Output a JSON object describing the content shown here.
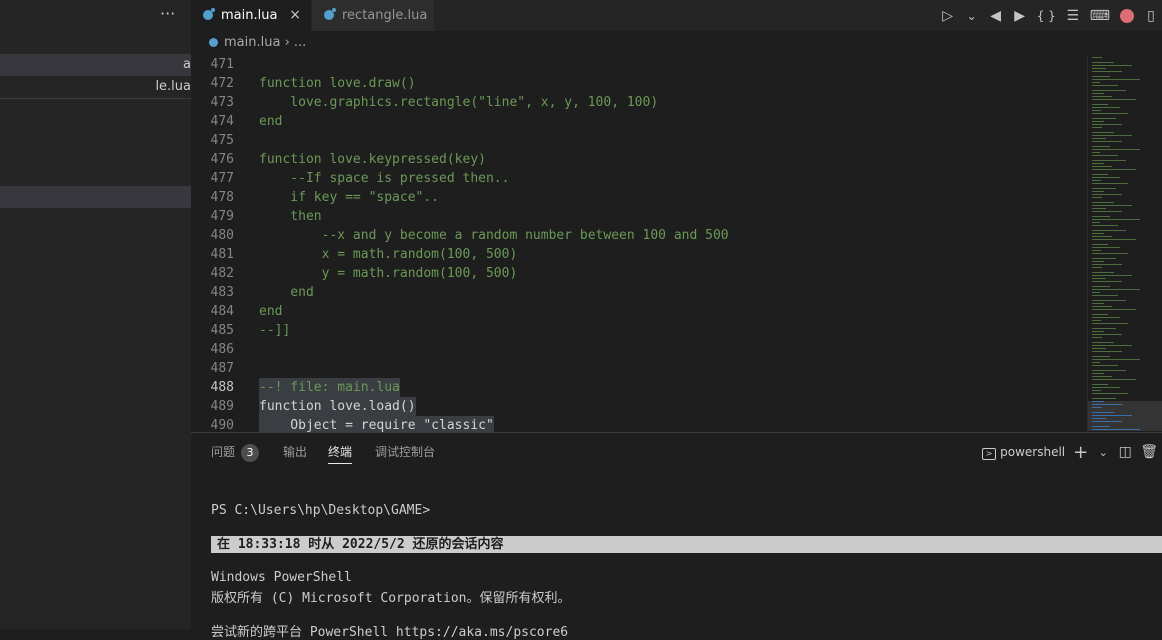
{
  "sidebar": {
    "more_label": "···",
    "files": [
      "a",
      "le.lua"
    ]
  },
  "tabs": [
    {
      "label": "main.lua",
      "close": "×"
    },
    {
      "label": "rectangle.lua"
    }
  ],
  "editor_actions": {
    "run": "▷",
    "run_menu": "⌄",
    "prev": "◀",
    "next": "▶",
    "braces": "{ }",
    "list": "☰",
    "terminal": "⌨",
    "split": "▯"
  },
  "breadcrumb": {
    "file": "main.lua",
    "sep": "›",
    "rest": "..."
  },
  "code_lines": [
    {
      "n": "471",
      "t": ""
    },
    {
      "n": "472",
      "t": "function love.draw()"
    },
    {
      "n": "473",
      "t": "    love.graphics.rectangle(\"line\", x, y, 100, 100)"
    },
    {
      "n": "474",
      "t": "end"
    },
    {
      "n": "475",
      "t": ""
    },
    {
      "n": "476",
      "t": "function love.keypressed(key)"
    },
    {
      "n": "477",
      "t": "    --If space is pressed then.."
    },
    {
      "n": "478",
      "t": "    if key == \"space\".."
    },
    {
      "n": "479",
      "t": "    then"
    },
    {
      "n": "480",
      "t": "        --x and y become a random number between 100 and 500"
    },
    {
      "n": "481",
      "t": "        x = math.random(100, 500)"
    },
    {
      "n": "482",
      "t": "        y = math.random(100, 500)"
    },
    {
      "n": "483",
      "t": "    end"
    },
    {
      "n": "484",
      "t": "end"
    },
    {
      "n": "485",
      "t": "--]]"
    },
    {
      "n": "486",
      "t": ""
    },
    {
      "n": "487",
      "t": ""
    },
    {
      "n": "488",
      "t": "--! file: main.lua"
    },
    {
      "n": "489",
      "t": "function love.load()"
    },
    {
      "n": "490",
      "t": "    Object = require \"classic\""
    }
  ],
  "panel": {
    "tabs": [
      {
        "label": "问题",
        "badge": "3"
      },
      {
        "label": "输出"
      },
      {
        "label": "终端"
      },
      {
        "label": "调试控制台"
      }
    ],
    "shell_label": "powershell",
    "add_label": "+",
    "chevron": "⌄",
    "split_icon": "◫",
    "trash_icon": "🗑"
  },
  "terminal": {
    "prompt": "PS C:\\Users\\hp\\Desktop\\GAME>",
    "restore_banner": "在 18:33:18 时从 2022/5/2 还原的会话内容",
    "line1": "Windows PowerShell",
    "line2": "版权所有 (C) Microsoft Corporation。保留所有权利。",
    "line3": "尝试新的跨平台 PowerShell https://aka.ms/pscore6"
  }
}
